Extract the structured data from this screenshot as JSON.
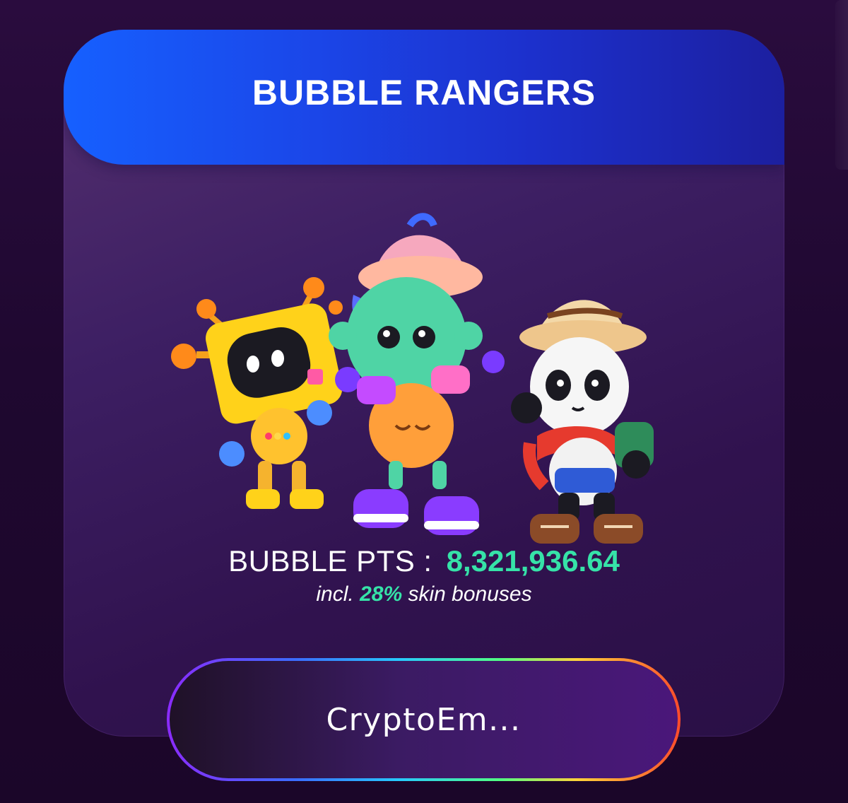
{
  "header": {
    "title": "BUBBLE RANGERS"
  },
  "stats": {
    "points_label": "BUBBLE PTS :",
    "points_value": "8,321,936.64",
    "bonus_prefix": "incl.",
    "bonus_percent": "28%",
    "bonus_suffix": "skin bonuses"
  },
  "wallet": {
    "label": "CryptoEm..."
  },
  "colors": {
    "accent_green": "#36e3a8",
    "header_blue": "#1b46e8",
    "card_purple": "#3d1f63"
  },
  "icons": [
    "robot-character-icon",
    "monkey-character-icon",
    "panda-character-icon"
  ]
}
